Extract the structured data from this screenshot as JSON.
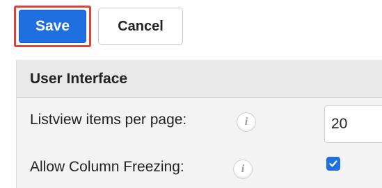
{
  "toolbar": {
    "save_label": "Save",
    "cancel_label": "Cancel"
  },
  "panel": {
    "title": "User Interface",
    "rows": [
      {
        "label": "Listview items per page:",
        "info_icon": "info-icon",
        "value": "20"
      },
      {
        "label": "Allow Column Freezing:",
        "info_icon": "info-icon",
        "checked": true
      }
    ]
  },
  "info_glyph": "i",
  "colors": {
    "primary_button": "#1f6fe0",
    "highlight_outline": "#d6453d",
    "panel_background": "#f3f3f3",
    "panel_header_background": "#e9e9e9",
    "checkbox": "#1f6fe0"
  }
}
